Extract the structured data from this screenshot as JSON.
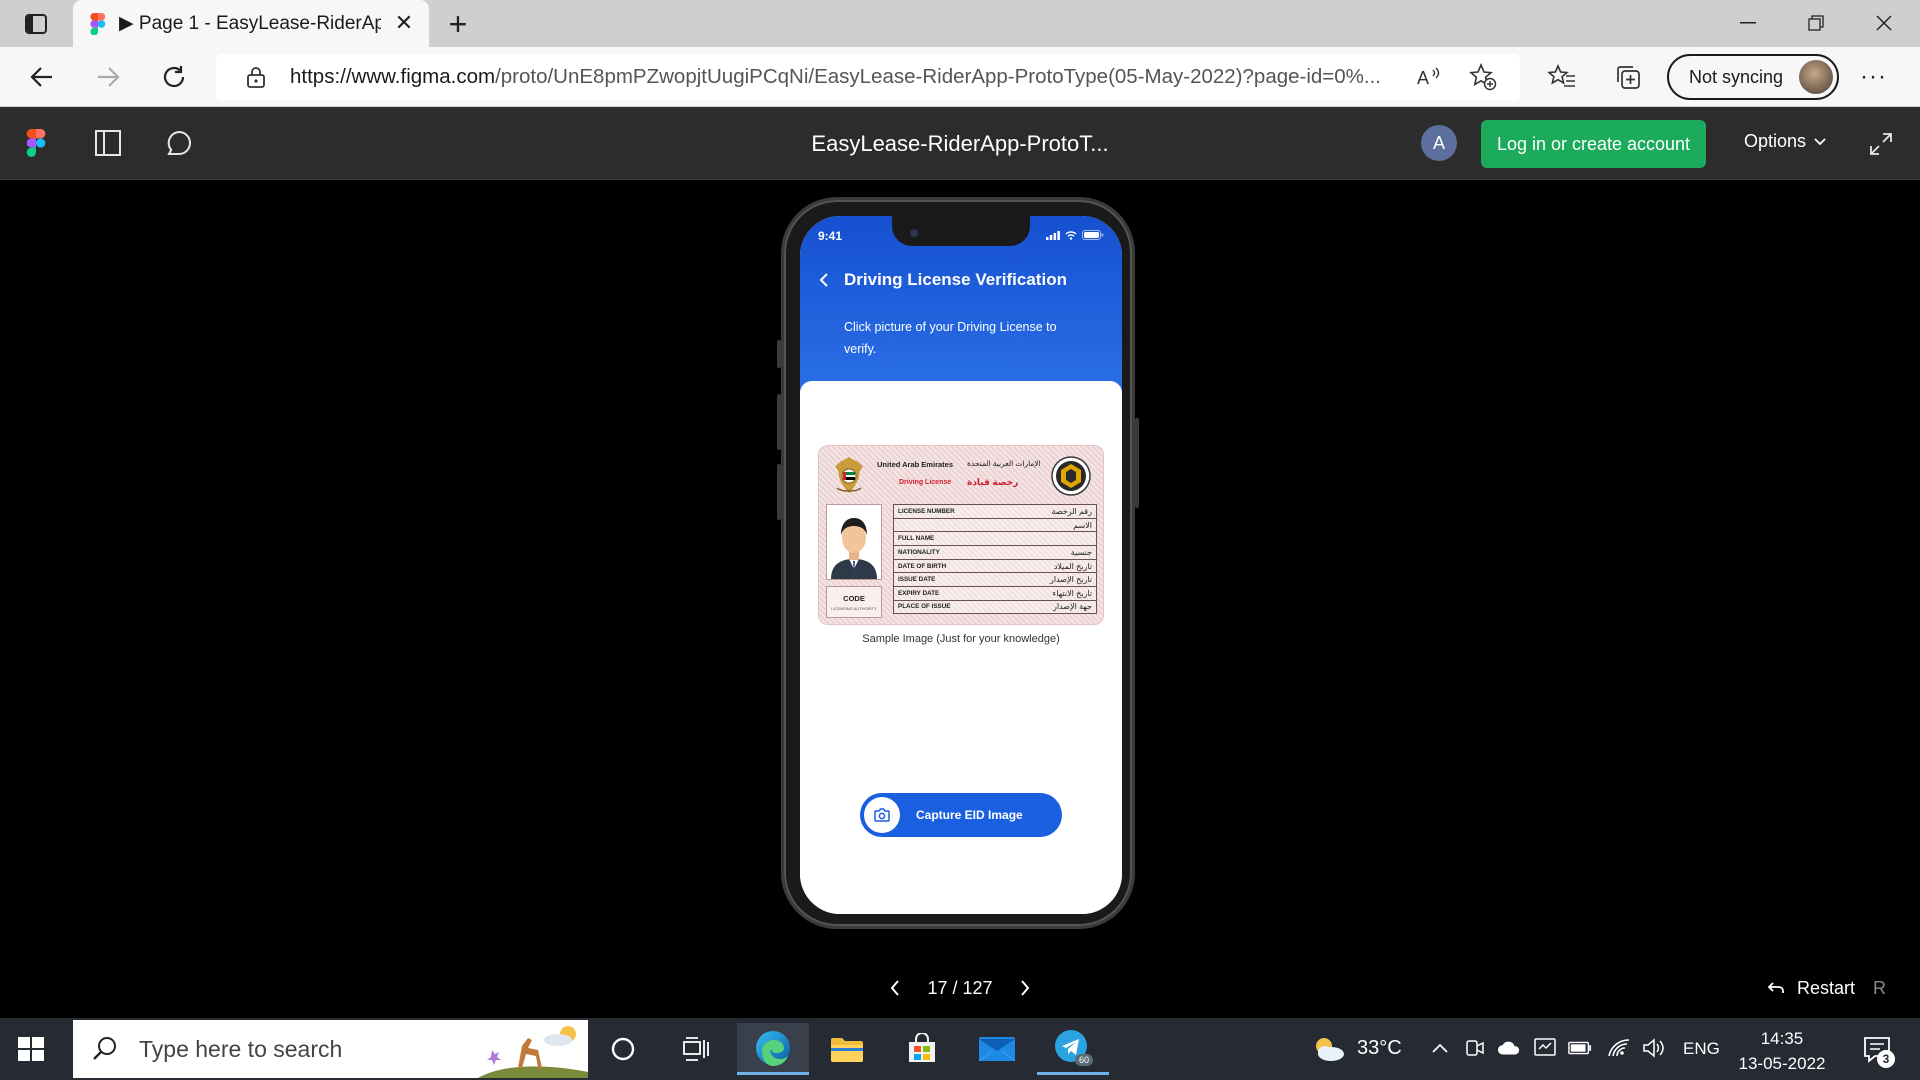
{
  "browser": {
    "tab_title": "▶ Page 1 - EasyLease-RiderApp-",
    "url_main": "https://www.figma.com",
    "url_rest": "/proto/UnE8pmPZwopjtUugiPCqNi/EasyLease-RiderApp-ProtoType(05-May-2022)?page-id=0%...",
    "sync_label": "Not syncing"
  },
  "figma": {
    "file_title": "EasyLease-RiderApp-ProtoT...",
    "avatar_initial": "A",
    "login_label": "Log in or create account",
    "options_label": "Options"
  },
  "phone": {
    "status_time": "9:41",
    "screen_title": "Driving License Verification",
    "screen_subtitle": "Click picture of your Driving License to verify.",
    "license": {
      "header_en": "United Arab Emirates",
      "header_ar": "الإمارات العربية المتحدة",
      "sub_en": "Driving License",
      "sub_ar": "رخصة قيادة",
      "code_label": "CODE",
      "code_sub": "LICENSING AUTHORITY",
      "rows": [
        {
          "en": "LICENSE NUMBER",
          "ar": "رقم الرخصة"
        },
        {
          "en": "",
          "ar": "الاسم"
        },
        {
          "en": "FULL NAME",
          "ar": ""
        },
        {
          "en": "NATIONALITY",
          "ar": "جنسية"
        },
        {
          "en": "DATE OF BIRTH",
          "ar": "تاريخ الميلاد"
        },
        {
          "en": "ISSUE DATE",
          "ar": "تاريخ الإصدار"
        },
        {
          "en": "EXPIRY DATE",
          "ar": "تاريخ الانتهاء"
        },
        {
          "en": "PLACE OF ISSUE",
          "ar": "جهة الإصدار"
        }
      ]
    },
    "caption": "Sample Image (Just for your knowledge)",
    "capture_label": "Capture EID Image"
  },
  "pager": {
    "text": "17 / 127",
    "restart_label": "Restart",
    "restart_key": "R"
  },
  "taskbar": {
    "search_placeholder": "Type here to search",
    "temperature": "33°C",
    "language": "ENG",
    "time": "14:35",
    "date": "13-05-2022",
    "notification_count": "3",
    "telegram_badge": "60"
  },
  "colors": {
    "figma_green": "#1bab5b",
    "app_blue": "#1a5fe0",
    "taskbar": "#252a33"
  }
}
